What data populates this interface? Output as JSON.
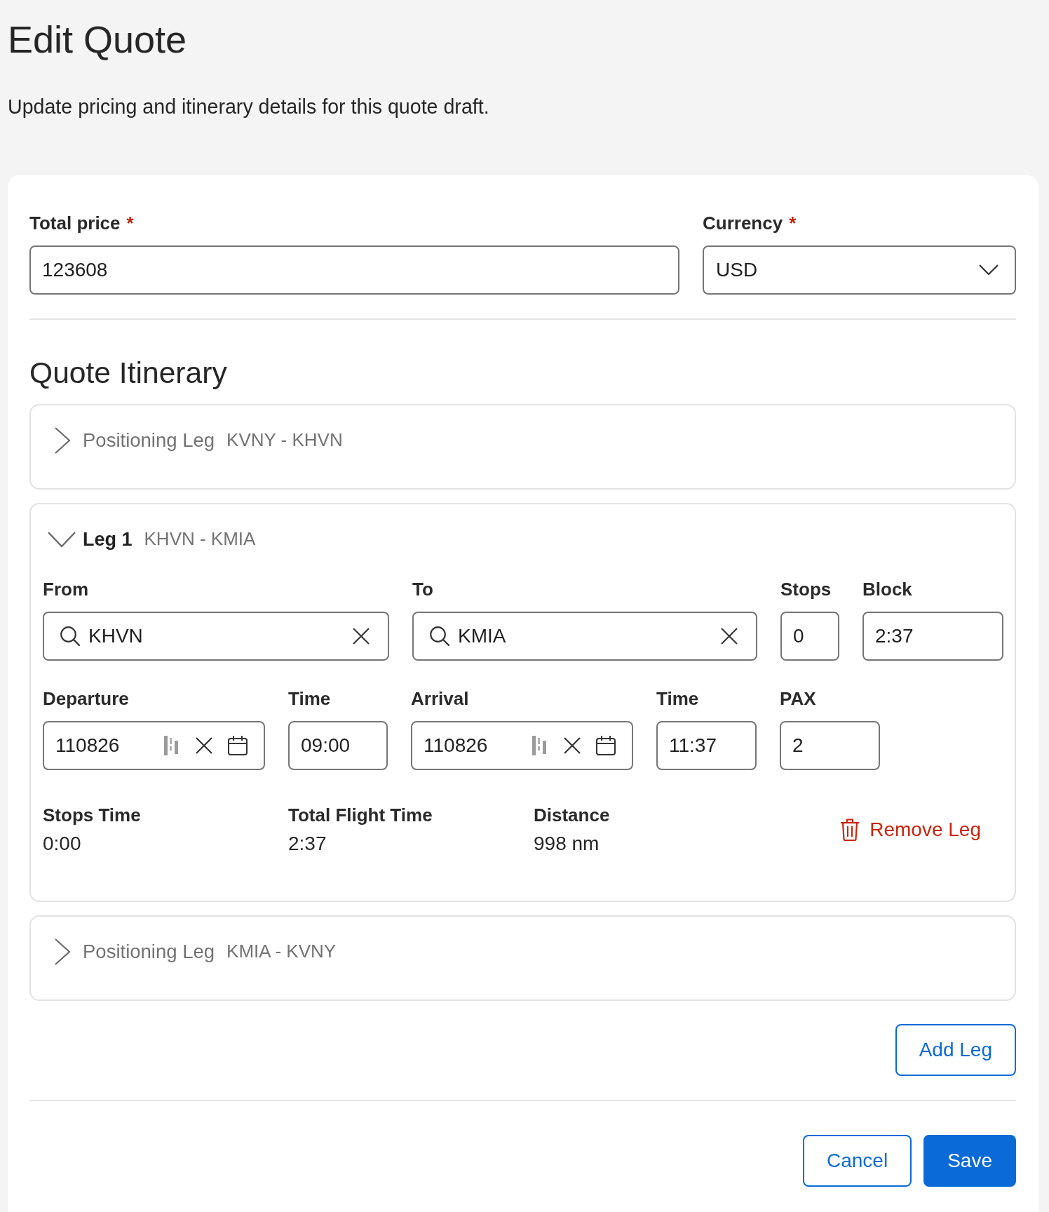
{
  "page": {
    "title": "Edit Quote",
    "subtitle": "Update pricing and itinerary details for this quote draft."
  },
  "pricing": {
    "fields": [
      {
        "label": "Total price",
        "required_mark": "*",
        "kind": "text",
        "value": "123608"
      },
      {
        "label": "Currency",
        "required_mark": "*",
        "kind": "select",
        "value": "USD"
      }
    ]
  },
  "itinerary": {
    "title": "Quote Itinerary",
    "legs": [
      {
        "kind": "positioning",
        "title": "Positioning Leg",
        "route": "KVNY - KHVN",
        "expanded": false
      },
      {
        "kind": "leg",
        "title": "Leg 1",
        "route": "KHVN - KMIA",
        "expanded": true,
        "rows": [
          {
            "fields": [
              {
                "label": "From",
                "kind": "search",
                "value": "KHVN"
              },
              {
                "label": "To",
                "kind": "search",
                "value": "KMIA"
              },
              {
                "label": "Stops",
                "kind": "text",
                "value": "0"
              },
              {
                "label": "Block",
                "kind": "text",
                "value": "2:37"
              }
            ]
          },
          {
            "fields": [
              {
                "label": "Departure",
                "kind": "date",
                "value": "110826"
              },
              {
                "label": "Time",
                "kind": "text",
                "value": "09:00"
              },
              {
                "label": "Arrival",
                "kind": "date",
                "value": "110826"
              },
              {
                "label": "Time",
                "kind": "text",
                "value": "11:37"
              },
              {
                "label": "PAX",
                "kind": "text",
                "value": "2"
              }
            ]
          }
        ],
        "summary": [
          {
            "label": "Stops Time",
            "value": "0:00"
          },
          {
            "label": "Total Flight Time",
            "value": "2:37"
          },
          {
            "label": "Distance",
            "value": "998 nm"
          }
        ],
        "remove_button": "Remove Leg"
      },
      {
        "kind": "positioning",
        "title": "Positioning Leg",
        "route": "KMIA - KVNY",
        "expanded": false
      }
    ],
    "add_button": "Add Leg"
  },
  "actions": [
    {
      "kind": "secondary",
      "label": "Cancel"
    },
    {
      "kind": "primary",
      "label": "Save"
    }
  ]
}
